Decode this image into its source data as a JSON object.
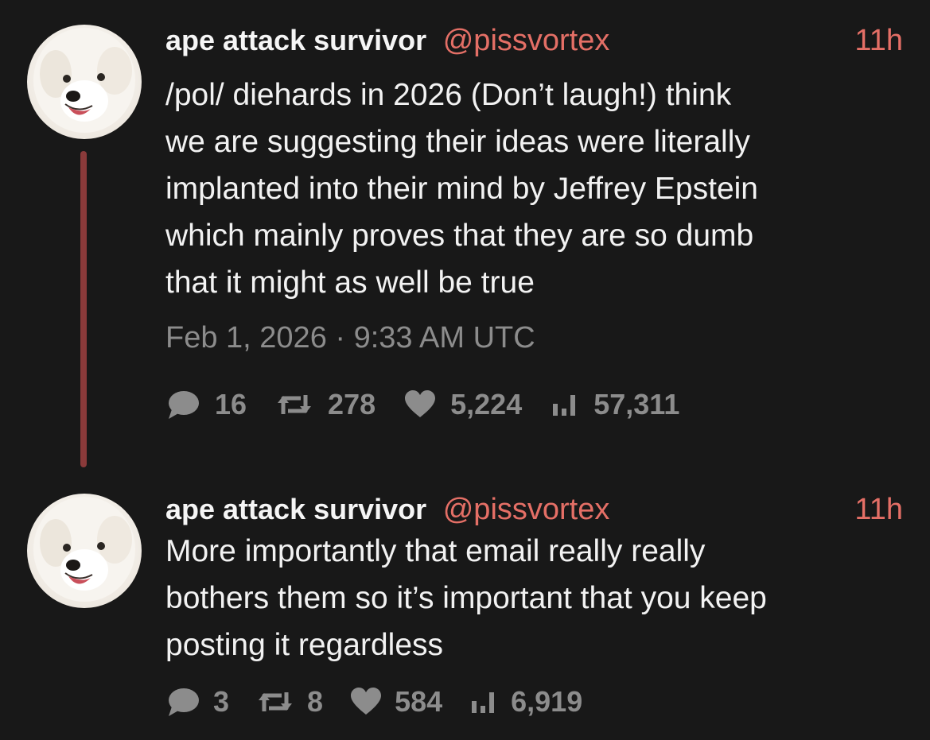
{
  "posts": [
    {
      "author": {
        "display_name": "ape attack survivor",
        "handle": "@pissvortex"
      },
      "relative_time": "11h",
      "text": "/pol/ diehards in 2026 (Don’t laugh!) think\nwe are suggesting their ideas were literally\nimplanted into their mind by Jeffrey Epstein\nwhich mainly proves that they are so dumb\nthat it might as well be true",
      "timestamp": "Feb 1, 2026 · 9:33 AM UTC",
      "stats": {
        "replies": "16",
        "reposts": "278",
        "likes": "5,224",
        "views": "57,311"
      }
    },
    {
      "author": {
        "display_name": "ape attack survivor",
        "handle": "@pissvortex"
      },
      "relative_time": "11h",
      "text": "More importantly that email really really\nbothers them so it’s important that you keep\nposting it regardless",
      "stats": {
        "replies": "3",
        "reposts": "8",
        "likes": "584",
        "views": "6,919"
      }
    }
  ],
  "icons": {
    "reply": "speech-bubble-icon",
    "repost": "repost-arrows-icon",
    "like": "heart-icon",
    "views": "bar-chart-icon"
  },
  "colors": {
    "background": "#181818",
    "accent": "#e46f66",
    "thread_line": "#8a3a3a",
    "muted": "#8c8c8c",
    "text": "#f2f2f2"
  }
}
